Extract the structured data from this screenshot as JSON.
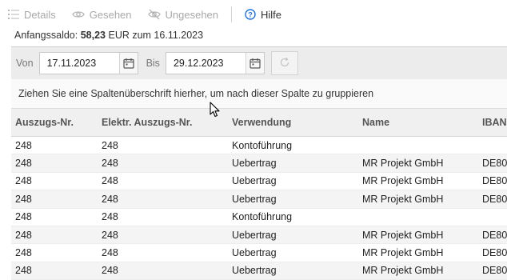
{
  "toolbar": {
    "details": "Details",
    "gesehen": "Gesehen",
    "ungesehen": "Ungesehen",
    "hilfe": "Hilfe"
  },
  "balance": {
    "label": "Anfangssaldo:",
    "amount": "58,23",
    "suffix": "EUR zum 16.11.2023"
  },
  "filter": {
    "from_label": "Von",
    "from_value": "17.11.2023",
    "to_label": "Bis",
    "to_value": "29.12.2023"
  },
  "group_panel": {
    "text": "Ziehen Sie eine Spaltenüberschrift hierher, um nach dieser Spalte zu gruppieren"
  },
  "table": {
    "headers": [
      "Auszugs-Nr.",
      "Elektr. Auszugs-Nr.",
      "Verwendung",
      "Name",
      "IBAN"
    ],
    "rows": [
      [
        "248",
        "248",
        "Kontoführung",
        "",
        ""
      ],
      [
        "248",
        "248",
        "Uebertrag",
        "MR Projekt GmbH",
        "DE80"
      ],
      [
        "248",
        "248",
        "Uebertrag",
        "MR Projekt GmbH",
        "DE80"
      ],
      [
        "248",
        "248",
        "Uebertrag",
        "MR Projekt GmbH",
        "DE80"
      ],
      [
        "248",
        "248",
        "Kontoführung",
        "",
        ""
      ],
      [
        "248",
        "248",
        "Uebertrag",
        "MR Projekt GmbH",
        "DE80"
      ],
      [
        "248",
        "248",
        "Uebertrag",
        "MR Projekt GmbH",
        "DE80"
      ],
      [
        "248",
        "248",
        "Uebertrag",
        "MR Projekt GmbH",
        "DE80"
      ]
    ]
  },
  "icons": {
    "details": "list-icon",
    "gesehen": "eye-icon",
    "ungesehen": "eye-off-icon",
    "hilfe": "help-circle-icon",
    "calendar": "calendar-icon",
    "refresh": "refresh-icon"
  },
  "colors": {
    "accent": "#1a73e8",
    "disabled": "#a9a9a9"
  }
}
